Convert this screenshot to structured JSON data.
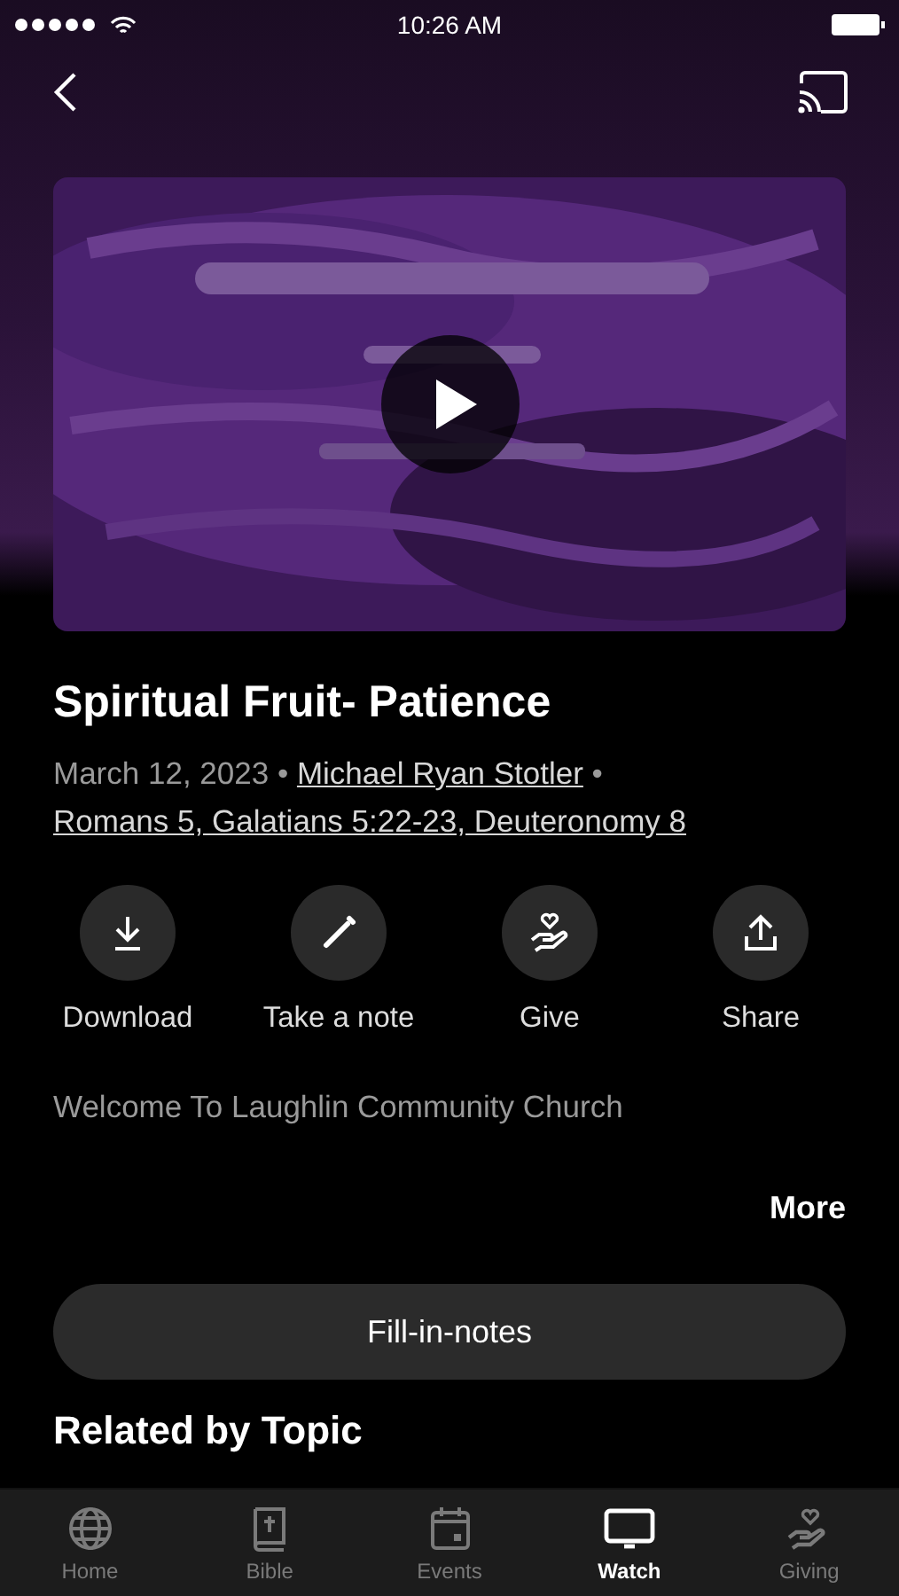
{
  "status_bar": {
    "time": "10:26 AM"
  },
  "sermon": {
    "title": "Spiritual Fruit- Patience",
    "date": "March 12, 2023",
    "separator": "•",
    "speaker": "Michael Ryan Stotler",
    "scripture": "Romans 5, Galatians 5:22-23, Deuteronomy 8"
  },
  "actions": [
    {
      "kind": "download",
      "label": "Download"
    },
    {
      "kind": "note",
      "label": "Take a note"
    },
    {
      "kind": "give",
      "label": "Give"
    },
    {
      "kind": "share",
      "label": "Share"
    }
  ],
  "description": "Welcome To Laughlin Community Church",
  "more_link": "More",
  "notes_button": "Fill-in-notes",
  "related_heading": "Related by Topic",
  "tab_bar": [
    {
      "kind": "home",
      "label": "Home",
      "selected": false
    },
    {
      "kind": "bible",
      "label": "Bible",
      "selected": false
    },
    {
      "kind": "events",
      "label": "Events",
      "selected": false
    },
    {
      "kind": "watch",
      "label": "Watch",
      "selected": true
    },
    {
      "kind": "giving",
      "label": "Giving",
      "selected": false
    }
  ]
}
